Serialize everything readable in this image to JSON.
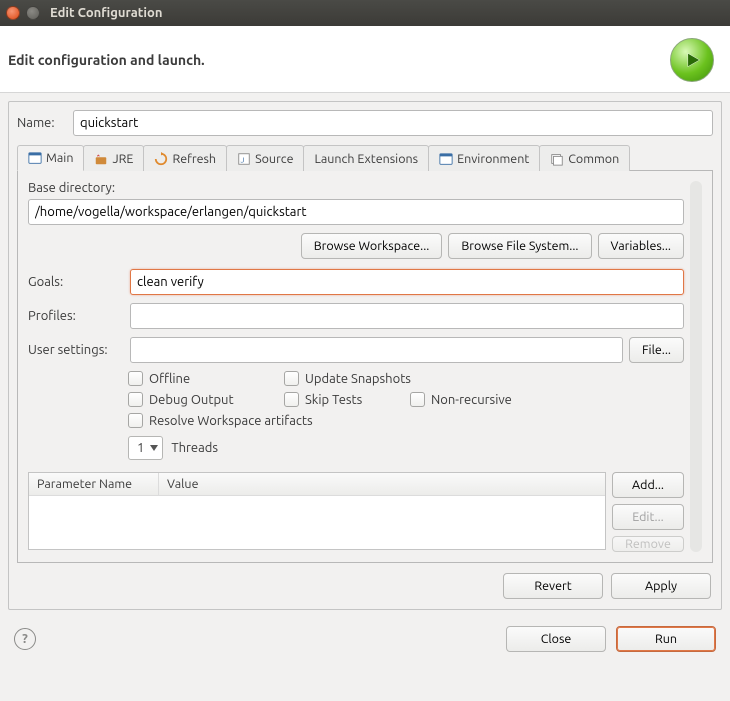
{
  "window": {
    "title": "Edit Configuration"
  },
  "header": {
    "title": "Edit configuration and launch."
  },
  "name": {
    "label": "Name:",
    "value": "quickstart"
  },
  "tabs": {
    "main": "Main",
    "jre": "JRE",
    "refresh": "Refresh",
    "source": "Source",
    "launch_ext": "Launch Extensions",
    "environment": "Environment",
    "common": "Common"
  },
  "main": {
    "base_dir_label": "Base directory:",
    "base_dir_value": "/home/vogella/workspace/erlangen/quickstart",
    "browse_ws": "Browse Workspace...",
    "browse_fs": "Browse File System...",
    "variables": "Variables...",
    "goals_label": "Goals:",
    "goals_value": "clean verify",
    "profiles_label": "Profiles:",
    "profiles_value": "",
    "user_settings_label": "User settings:",
    "user_settings_value": "",
    "file_btn": "File...",
    "chk_offline": "Offline",
    "chk_update": "Update Snapshots",
    "chk_debug": "Debug Output",
    "chk_skip": "Skip Tests",
    "chk_nonrec": "Non-recursive",
    "chk_resolve": "Resolve Workspace artifacts",
    "threads_value": "1",
    "threads_label": "Threads",
    "table": {
      "col1": "Parameter Name",
      "col2": "Value",
      "add": "Add...",
      "edit": "Edit...",
      "remove": "Remove"
    }
  },
  "buttons": {
    "revert": "Revert",
    "apply": "Apply",
    "close": "Close",
    "run": "Run"
  }
}
